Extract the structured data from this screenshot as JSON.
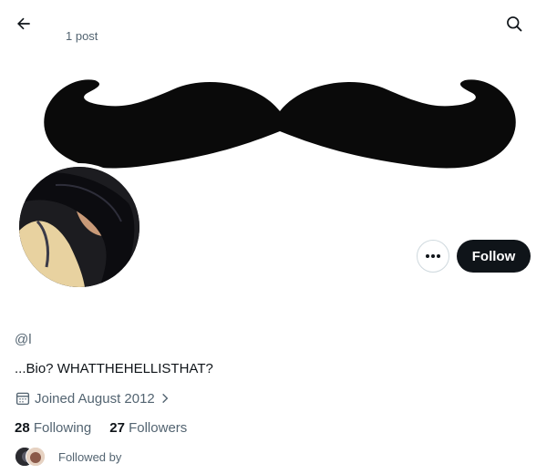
{
  "header": {
    "post_count": "1 post",
    "back_icon": "arrow-left-icon",
    "search_icon": "search-icon"
  },
  "banner": {
    "image": "mustache-banner"
  },
  "profile": {
    "handle": "@l",
    "bio": "...Bio? WHATTHEHELLISTHAT?",
    "joined": "Joined August 2012",
    "following_count": "28",
    "following_label": "Following",
    "followers_count": "27",
    "followers_label": "Followers",
    "followed_by": "Followed by"
  },
  "actions": {
    "follow_label": "Follow",
    "more_icon": "more-dots-icon"
  },
  "colors": {
    "text": "#0f1419",
    "secondary_text": "#536471",
    "button_dark": "#0f1419",
    "border": "#cfd9de"
  }
}
